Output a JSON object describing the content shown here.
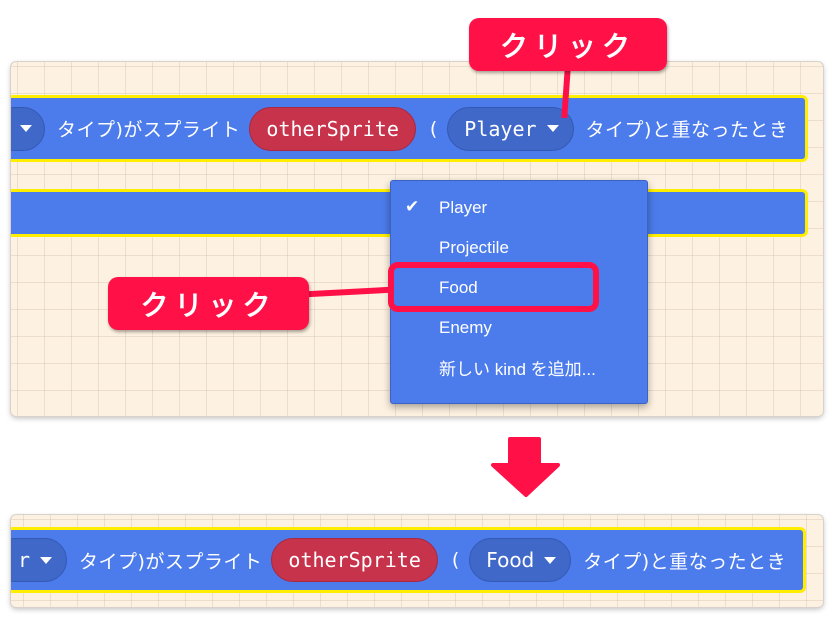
{
  "top_block": {
    "left_dropdown_caret": "▾",
    "text_before_sprite": "タイプ)がスプライト",
    "sprite_variable": "otherSprite",
    "open_paren": "(",
    "kind_dropdown_value": "Player",
    "text_after": "タイプ)と重なったとき"
  },
  "dropdown_menu": {
    "selected_check": "✔",
    "items": [
      {
        "label": "Player",
        "selected": true
      },
      {
        "label": "Projectile",
        "selected": false
      },
      {
        "label": "Food",
        "selected": false,
        "highlighted": true
      },
      {
        "label": "Enemy",
        "selected": false
      },
      {
        "label": "新しい kind を追加...",
        "selected": false
      }
    ]
  },
  "annotations": {
    "callout_top": "クリック",
    "callout_left": "クリック",
    "arrow": "down-arrow",
    "accent_color": "#ff1148"
  },
  "bottom_block": {
    "left_dropdown_fragment": "r",
    "text_before_sprite": "タイプ)がスプライト",
    "sprite_variable": "otherSprite",
    "open_paren": "(",
    "kind_dropdown_value": "Food",
    "text_after": "タイプ)と重なったとき"
  },
  "colors": {
    "block_blue": "#4c7ceb",
    "block_outline": "#ffee00",
    "variable_red": "#c8334c",
    "workspace_bg": "#fdf1e1"
  }
}
